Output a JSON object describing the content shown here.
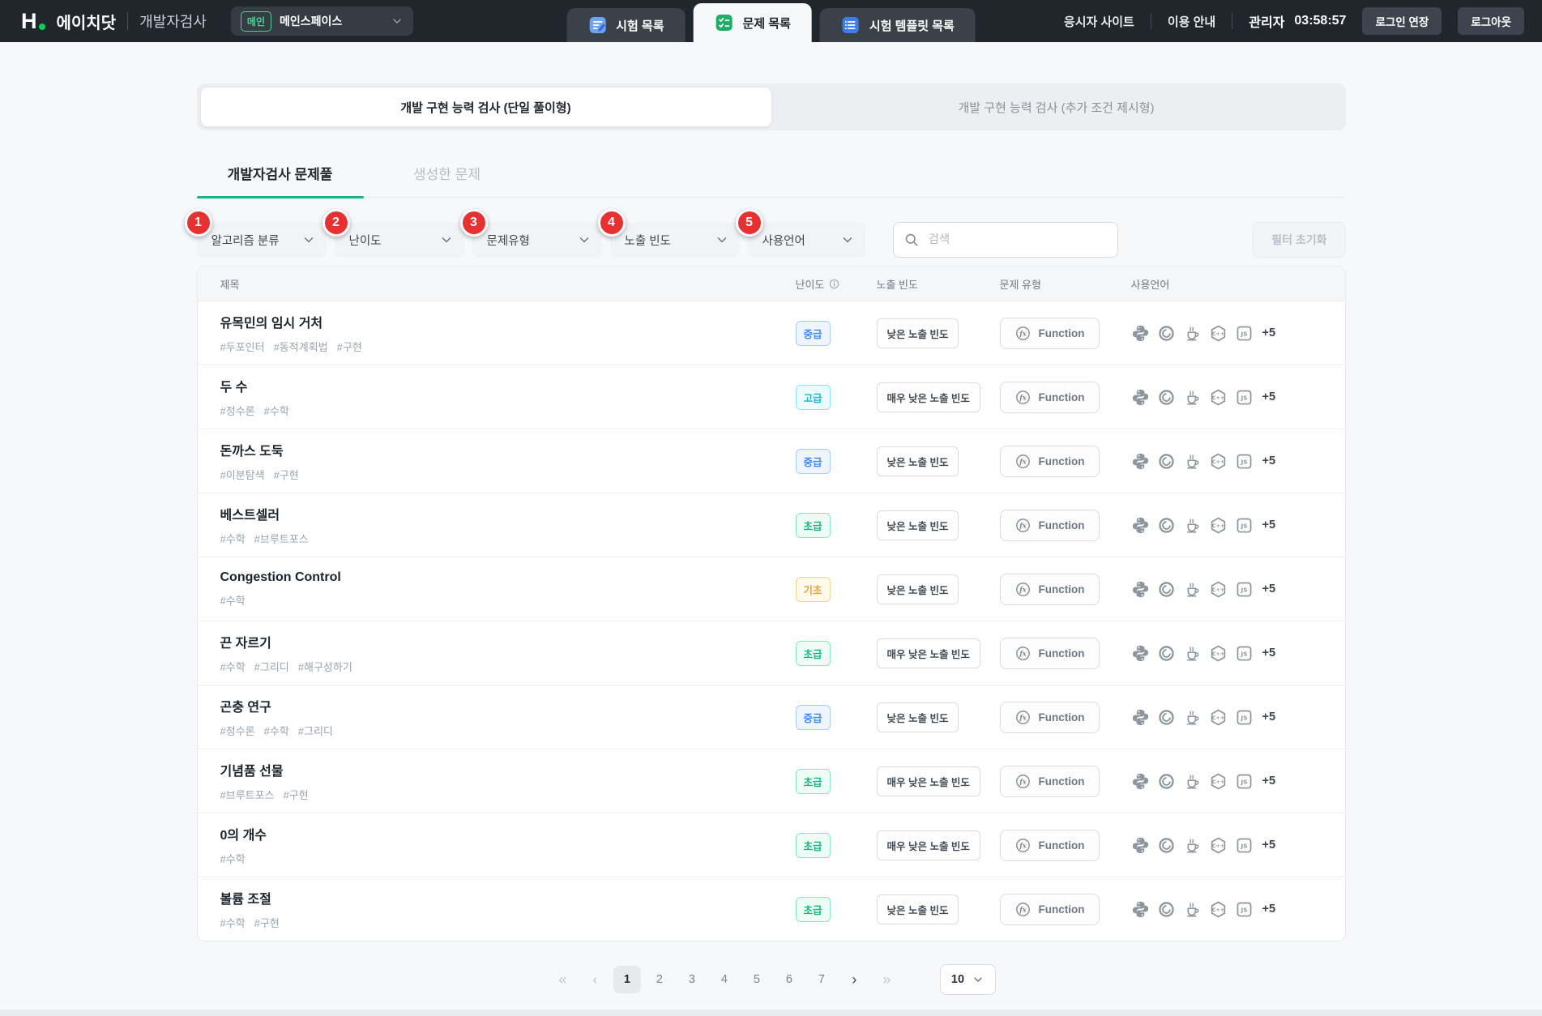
{
  "colors": {
    "brand_green": "#00d455",
    "nav_background": "#21262c",
    "tab_underline_green": "#12b886",
    "filter_badge_red": "#e93030",
    "difficulty_intermediate_blue": "#3d8bfd",
    "difficulty_advanced_cyan": "#17b8ce",
    "difficulty_beginner_green": "#10b981",
    "difficulty_basic_amber": "#e9a23b"
  },
  "navbar": {
    "logo": {
      "mark": "H",
      "brand": "에이치닷",
      "product": "개발자검사"
    },
    "workspace": {
      "badge": "메인",
      "name": "메인스페이스",
      "chevron_icon": "chevron-down-icon"
    },
    "tabs": [
      {
        "name": "tab-exam-list",
        "label": "시험 목록",
        "icon": "exam-list-icon",
        "active": false
      },
      {
        "name": "tab-problem-list",
        "label": "문제 목록",
        "icon": "problem-list-icon",
        "active": true
      },
      {
        "name": "tab-template-list",
        "label": "시험 템플릿 목록",
        "icon": "template-list-icon",
        "active": false
      }
    ],
    "links": [
      "응시자 사이트",
      "이용 안내"
    ],
    "user_role": "관리자",
    "session_timer": "03:58:57",
    "extend_login_label": "로그인 연장",
    "logout_label": "로그아웃"
  },
  "segmented": {
    "left": "개발 구현 능력 검사 (단일 풀이형)",
    "right": "개발 구현 능력 검사 (추가 조건 제시형)"
  },
  "pool_tabs": {
    "pool": "개발자검사 문제풀",
    "created": "생성한 문제"
  },
  "filters": {
    "dropdowns": [
      {
        "name": "filter-algorithm",
        "num": "1",
        "label": "알고리즘 분류"
      },
      {
        "name": "filter-difficulty",
        "num": "2",
        "label": "난이도"
      },
      {
        "name": "filter-problem-type",
        "num": "3",
        "label": "문제유형"
      },
      {
        "name": "filter-exposure",
        "num": "4",
        "label": "노출 빈도"
      },
      {
        "name": "filter-language",
        "num": "5",
        "label": "사용언어"
      }
    ],
    "search_placeholder": "검색",
    "reset_label": "필터 초기화"
  },
  "table": {
    "headers": {
      "title": "제목",
      "difficulty": "난이도",
      "exposure": "노출 빈도",
      "type": "문제 유형",
      "languages": "사용언어"
    },
    "language_icons": [
      "python-icon",
      "ring-lang-icon",
      "java-icon",
      "cpp-icon",
      "js-icon"
    ],
    "rows": [
      {
        "title": "유목민의 임시 거처",
        "tags": [
          "#두포인터",
          "#동적계획법",
          "#구현"
        ],
        "difficulty": {
          "label": "중급",
          "level": "intermediate"
        },
        "exposure": "낮은 노출 빈도",
        "type": "Function",
        "more": "+5"
      },
      {
        "title": "두 수",
        "tags": [
          "#정수론",
          "#수학"
        ],
        "difficulty": {
          "label": "고급",
          "level": "advanced"
        },
        "exposure": "매우 낮은 노출 빈도",
        "type": "Function",
        "more": "+5"
      },
      {
        "title": "돈까스 도둑",
        "tags": [
          "#이분탐색",
          "#구현"
        ],
        "difficulty": {
          "label": "중급",
          "level": "intermediate"
        },
        "exposure": "낮은 노출 빈도",
        "type": "Function",
        "more": "+5"
      },
      {
        "title": "베스트셀러",
        "tags": [
          "#수학",
          "#브루트포스"
        ],
        "difficulty": {
          "label": "초급",
          "level": "beginner"
        },
        "exposure": "낮은 노출 빈도",
        "type": "Function",
        "more": "+5"
      },
      {
        "title": "Congestion Control",
        "tags": [
          "#수학"
        ],
        "difficulty": {
          "label": "기초",
          "level": "basic"
        },
        "exposure": "낮은 노출 빈도",
        "type": "Function",
        "more": "+5"
      },
      {
        "title": "끈 자르기",
        "tags": [
          "#수학",
          "#그리디",
          "#해구성하기"
        ],
        "difficulty": {
          "label": "초급",
          "level": "beginner"
        },
        "exposure": "매우 낮은 노출 빈도",
        "type": "Function",
        "more": "+5"
      },
      {
        "title": "곤충 연구",
        "tags": [
          "#정수론",
          "#수학",
          "#그리디"
        ],
        "difficulty": {
          "label": "중급",
          "level": "intermediate"
        },
        "exposure": "낮은 노출 빈도",
        "type": "Function",
        "more": "+5"
      },
      {
        "title": "기념품 선물",
        "tags": [
          "#브루트포스",
          "#구현"
        ],
        "difficulty": {
          "label": "초급",
          "level": "beginner"
        },
        "exposure": "매우 낮은 노출 빈도",
        "type": "Function",
        "more": "+5"
      },
      {
        "title": "0의 개수",
        "tags": [
          "#수학"
        ],
        "difficulty": {
          "label": "초급",
          "level": "beginner"
        },
        "exposure": "매우 낮은 노출 빈도",
        "type": "Function",
        "more": "+5"
      },
      {
        "title": "볼륨 조절",
        "tags": [
          "#수학",
          "#구현"
        ],
        "difficulty": {
          "label": "초급",
          "level": "beginner"
        },
        "exposure": "낮은 노출 빈도",
        "type": "Function",
        "more": "+5"
      }
    ]
  },
  "pagination": {
    "first": "«",
    "prev": "‹",
    "pages": [
      "1",
      "2",
      "3",
      "4",
      "5",
      "6",
      "7"
    ],
    "active": "1",
    "next": "›",
    "last": "»",
    "page_size": "10"
  }
}
